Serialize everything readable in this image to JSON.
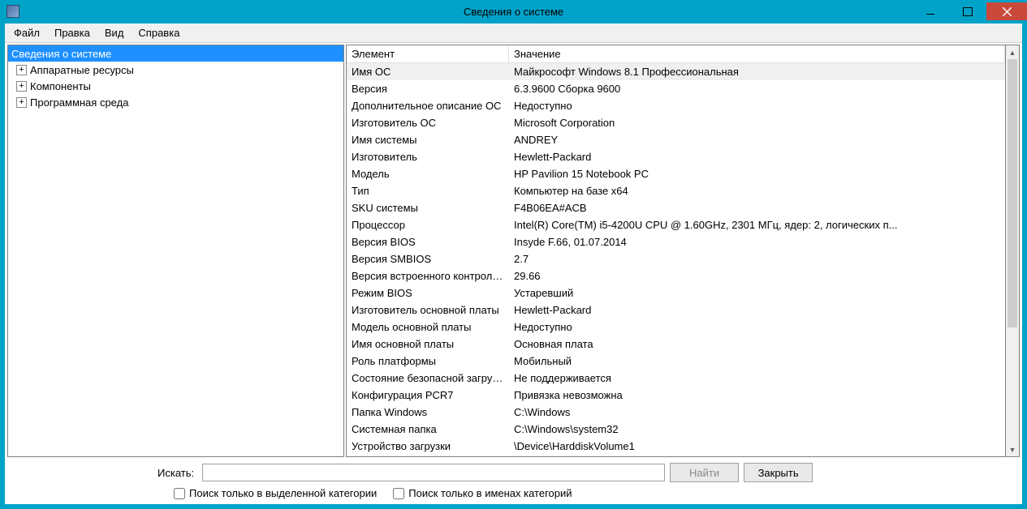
{
  "window": {
    "title": "Сведения о системе"
  },
  "menu": {
    "file": "Файл",
    "edit": "Правка",
    "view": "Вид",
    "help": "Справка"
  },
  "tree": {
    "root": "Сведения о системе",
    "children": [
      "Аппаратные ресурсы",
      "Компоненты",
      "Программная среда"
    ]
  },
  "list": {
    "headers": {
      "element": "Элемент",
      "value": "Значение"
    },
    "rows": [
      {
        "k": "Имя ОС",
        "v": "Майкрософт Windows 8.1 Профессиональная",
        "sel": true
      },
      {
        "k": "Версия",
        "v": "6.3.9600 Сборка 9600"
      },
      {
        "k": "Дополнительное описание ОС",
        "v": "Недоступно"
      },
      {
        "k": "Изготовитель ОС",
        "v": "Microsoft Corporation"
      },
      {
        "k": "Имя системы",
        "v": "ANDREY"
      },
      {
        "k": "Изготовитель",
        "v": "Hewlett-Packard"
      },
      {
        "k": "Модель",
        "v": "HP Pavilion 15 Notebook PC"
      },
      {
        "k": "Тип",
        "v": "Компьютер на базе x64"
      },
      {
        "k": "SKU системы",
        "v": "F4B06EA#ACB"
      },
      {
        "k": "Процессор",
        "v": "Intel(R) Core(TM) i5-4200U CPU @ 1.60GHz, 2301 МГц, ядер: 2, логических п..."
      },
      {
        "k": "Версия BIOS",
        "v": "Insyde F.66, 01.07.2014"
      },
      {
        "k": "Версия SMBIOS",
        "v": "2.7"
      },
      {
        "k": "Версия встроенного контролл...",
        "v": "29.66"
      },
      {
        "k": "Режим BIOS",
        "v": "Устаревший"
      },
      {
        "k": "Изготовитель основной платы",
        "v": "Hewlett-Packard"
      },
      {
        "k": "Модель основной платы",
        "v": "Недоступно"
      },
      {
        "k": "Имя основной платы",
        "v": "Основная плата"
      },
      {
        "k": "Роль платформы",
        "v": "Мобильный"
      },
      {
        "k": "Состояние безопасной загруз...",
        "v": "Не поддерживается"
      },
      {
        "k": "Конфигурация PCR7",
        "v": "Привязка невозможна"
      },
      {
        "k": "Папка Windows",
        "v": "C:\\Windows"
      },
      {
        "k": "Системная папка",
        "v": "C:\\Windows\\system32"
      },
      {
        "k": "Устройство загрузки",
        "v": "\\Device\\HarddiskVolume1"
      }
    ]
  },
  "search": {
    "label": "Искать:",
    "find": "Найти",
    "close": "Закрыть",
    "chk1": "Поиск только в выделенной категории",
    "chk2": "Поиск только в именах категорий"
  }
}
